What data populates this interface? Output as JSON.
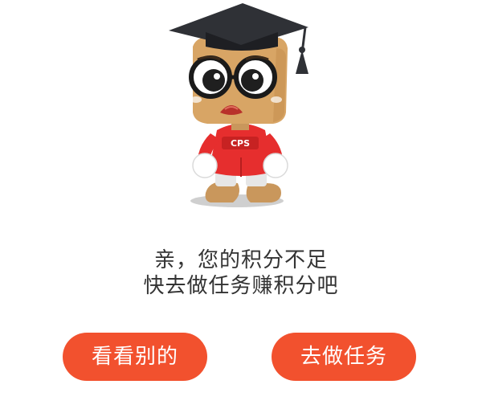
{
  "mascot": {
    "icon": "graduate-mascot-icon",
    "shirt_text": "CPS"
  },
  "message": {
    "line1": "亲，您的积分不足",
    "line2": "快去做任务赚积分吧"
  },
  "buttons": {
    "browse_label": "看看别的",
    "task_label": "去做任务"
  },
  "colors": {
    "accent": "#f2512e",
    "text": "#333333",
    "background": "#ffffff"
  }
}
